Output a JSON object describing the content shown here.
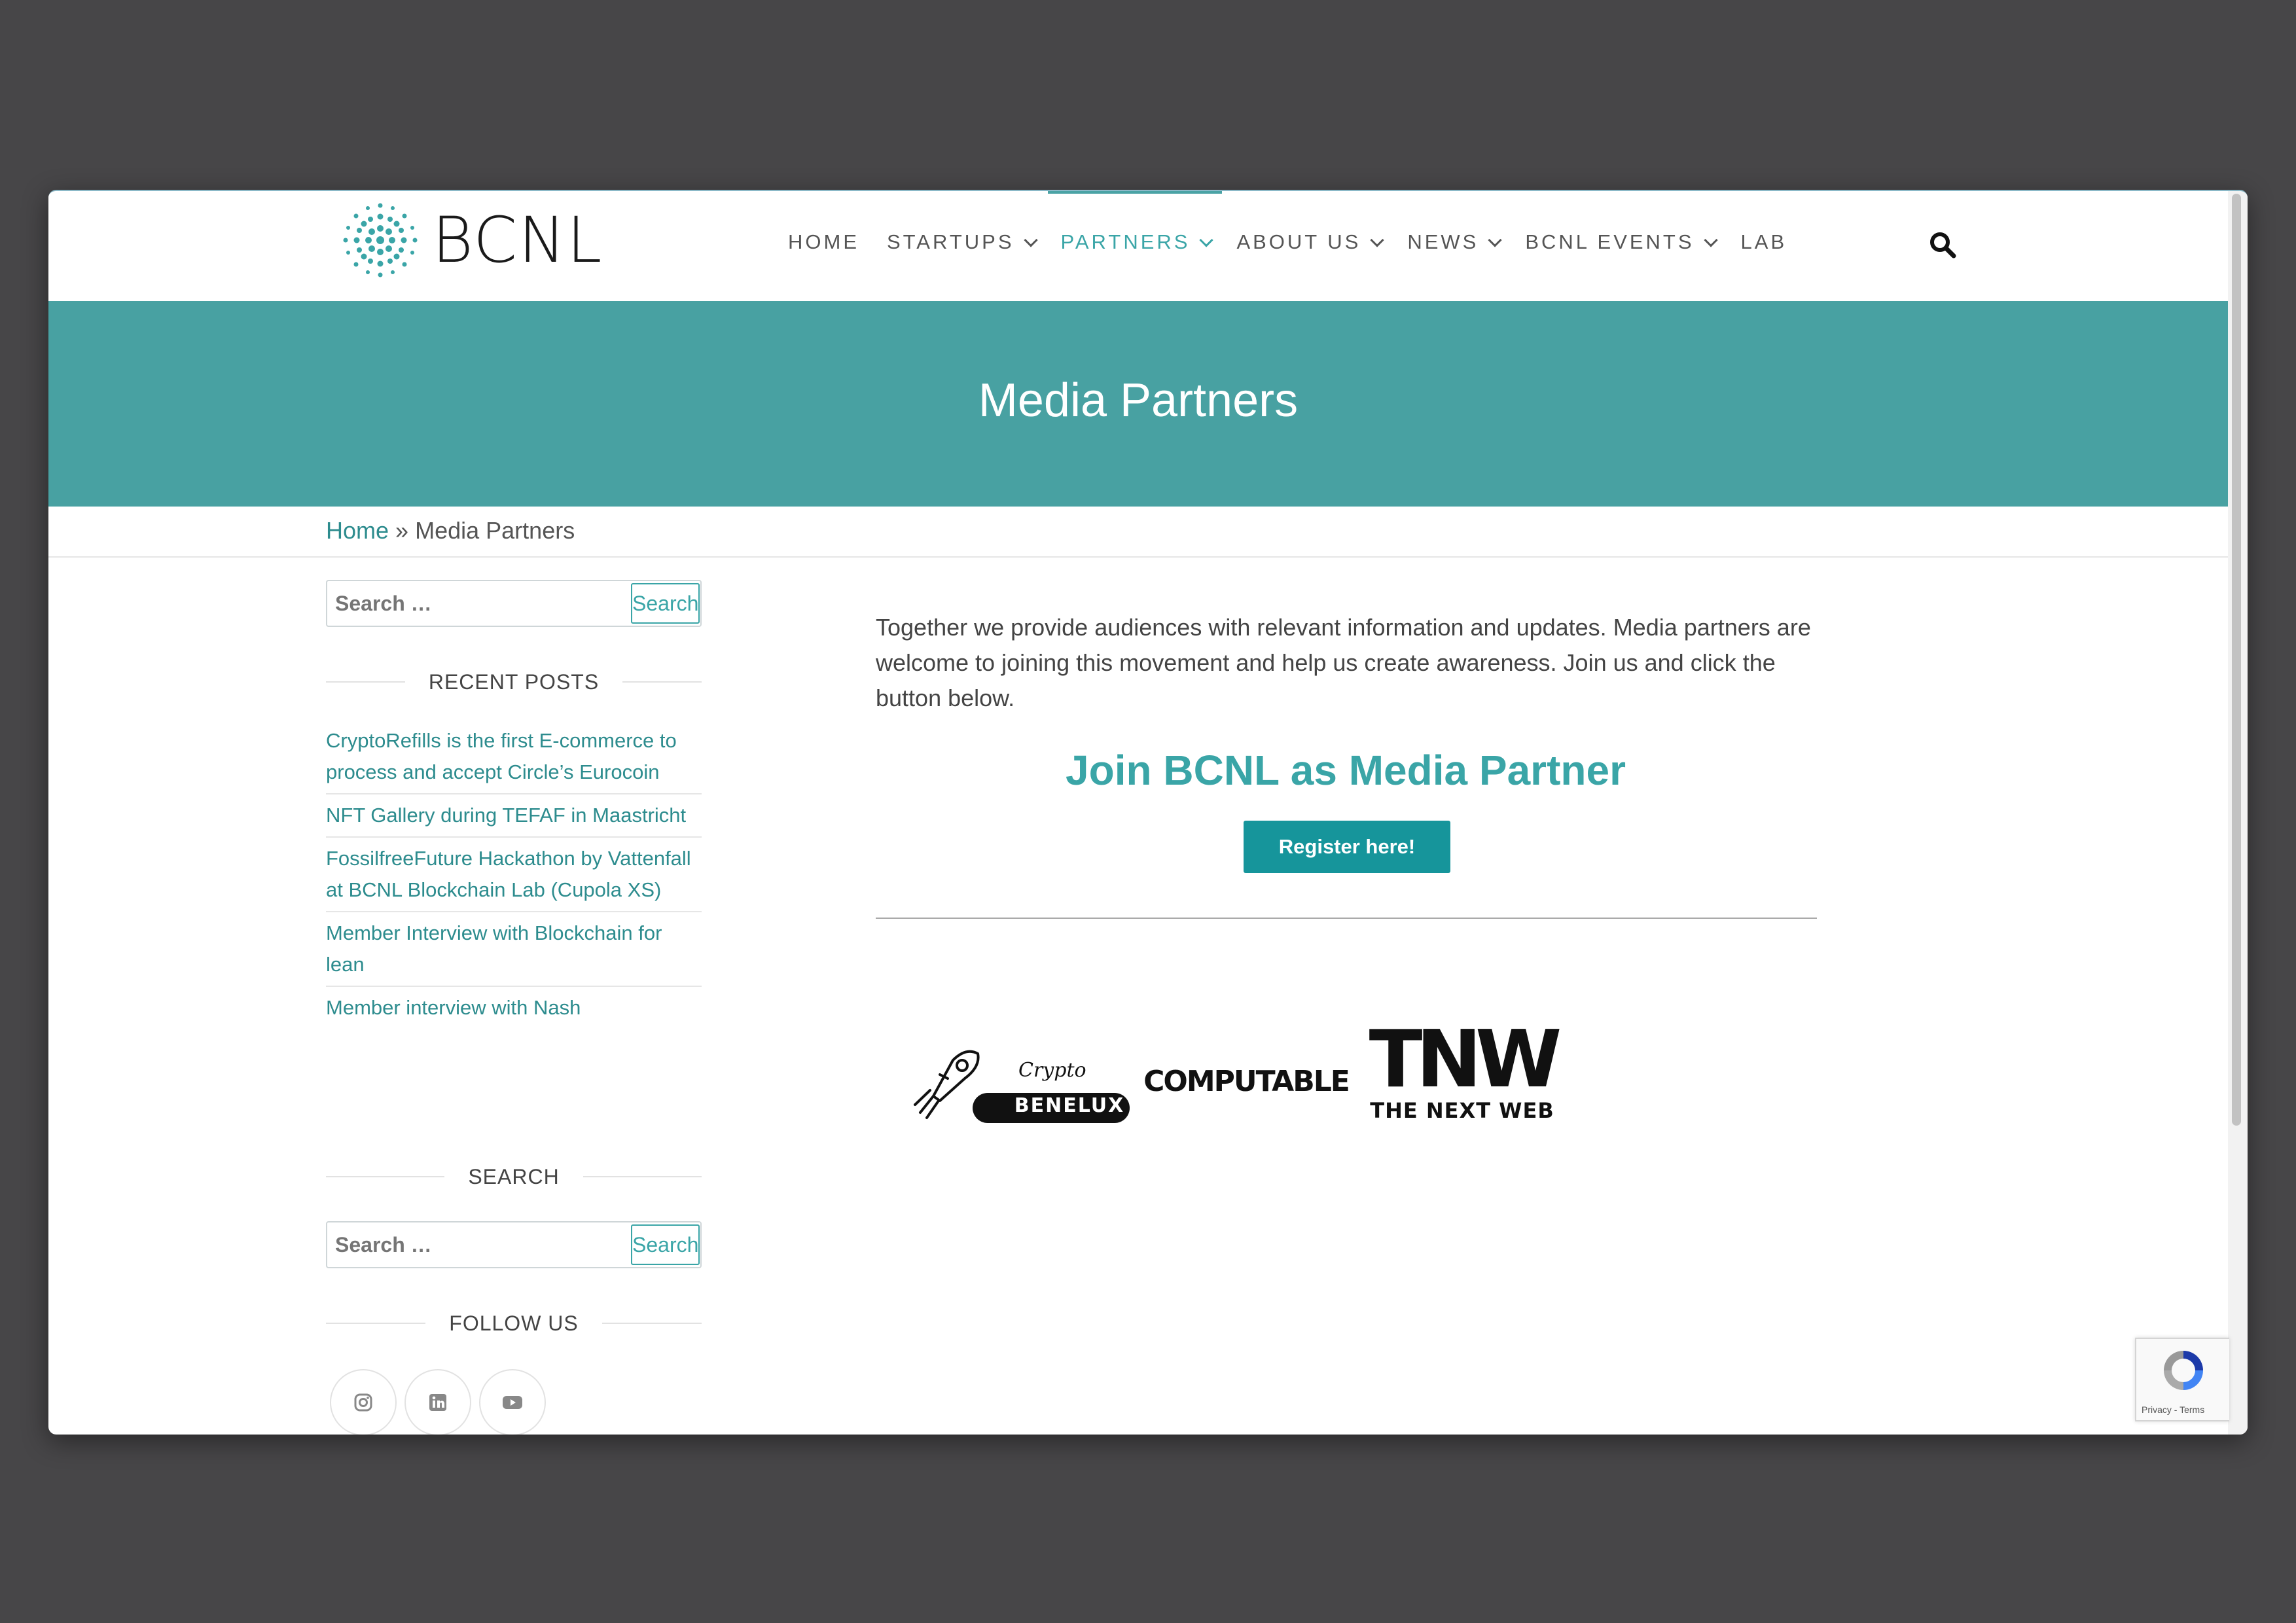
{
  "header": {
    "logo_text": "BCNL",
    "nav": [
      {
        "label": "HOME",
        "dropdown": false
      },
      {
        "label": "STARTUPS",
        "dropdown": true
      },
      {
        "label": "PARTNERS",
        "dropdown": true,
        "active": true
      },
      {
        "label": "ABOUT US",
        "dropdown": true
      },
      {
        "label": "NEWS",
        "dropdown": true
      },
      {
        "label": "BCNL EVENTS",
        "dropdown": true
      },
      {
        "label": "LAB",
        "dropdown": false
      }
    ],
    "search_icon": "search-icon"
  },
  "hero": {
    "title": "Media Partners"
  },
  "breadcrumb": {
    "home": "Home",
    "separator": "»",
    "current": "Media Partners"
  },
  "sidebar": {
    "search_top": {
      "placeholder": "Search …",
      "button": "Search"
    },
    "recent_posts_title": "RECENT POSTS",
    "recent_posts": [
      "CryptoRefills is the first E-commerce to process and accept Circle’s Eurocoin",
      "NFT Gallery during TEFAF in Maastricht",
      "FossilfreeFuture Hackathon by Vattenfall at BCNL Blockchain Lab (Cupola XS)",
      "Member Interview with Blockchain for lean",
      "Member interview with Nash"
    ],
    "search_title": "SEARCH",
    "search_bottom": {
      "placeholder": "Search …",
      "button": "Search"
    },
    "follow_title": "FOLLOW US",
    "social_icons": [
      "instagram-icon",
      "linkedin-icon",
      "youtube-icon"
    ]
  },
  "main": {
    "intro": "Together we provide audiences with relevant information and updates. Media partners are welcome to joining this movement and help us create awareness. Join us and click the button below.",
    "join_heading": "Join BCNL as Media Partner",
    "register_button": "Register here!",
    "partners": [
      {
        "name": "Crypto Benelux",
        "line1": "Crypto",
        "line2": "BENELUX"
      },
      {
        "name": "Computable",
        "text": "COMPUTABLE"
      },
      {
        "name": "TNW",
        "line1": "TNW",
        "line2": "THE NEXT WEB"
      }
    ]
  },
  "recaptcha": {
    "text": "Privacy - Terms"
  },
  "colors": {
    "accent": "#48a1a2",
    "link": "#2d8c8e",
    "button": "#16959b",
    "backdrop": "#474648"
  }
}
